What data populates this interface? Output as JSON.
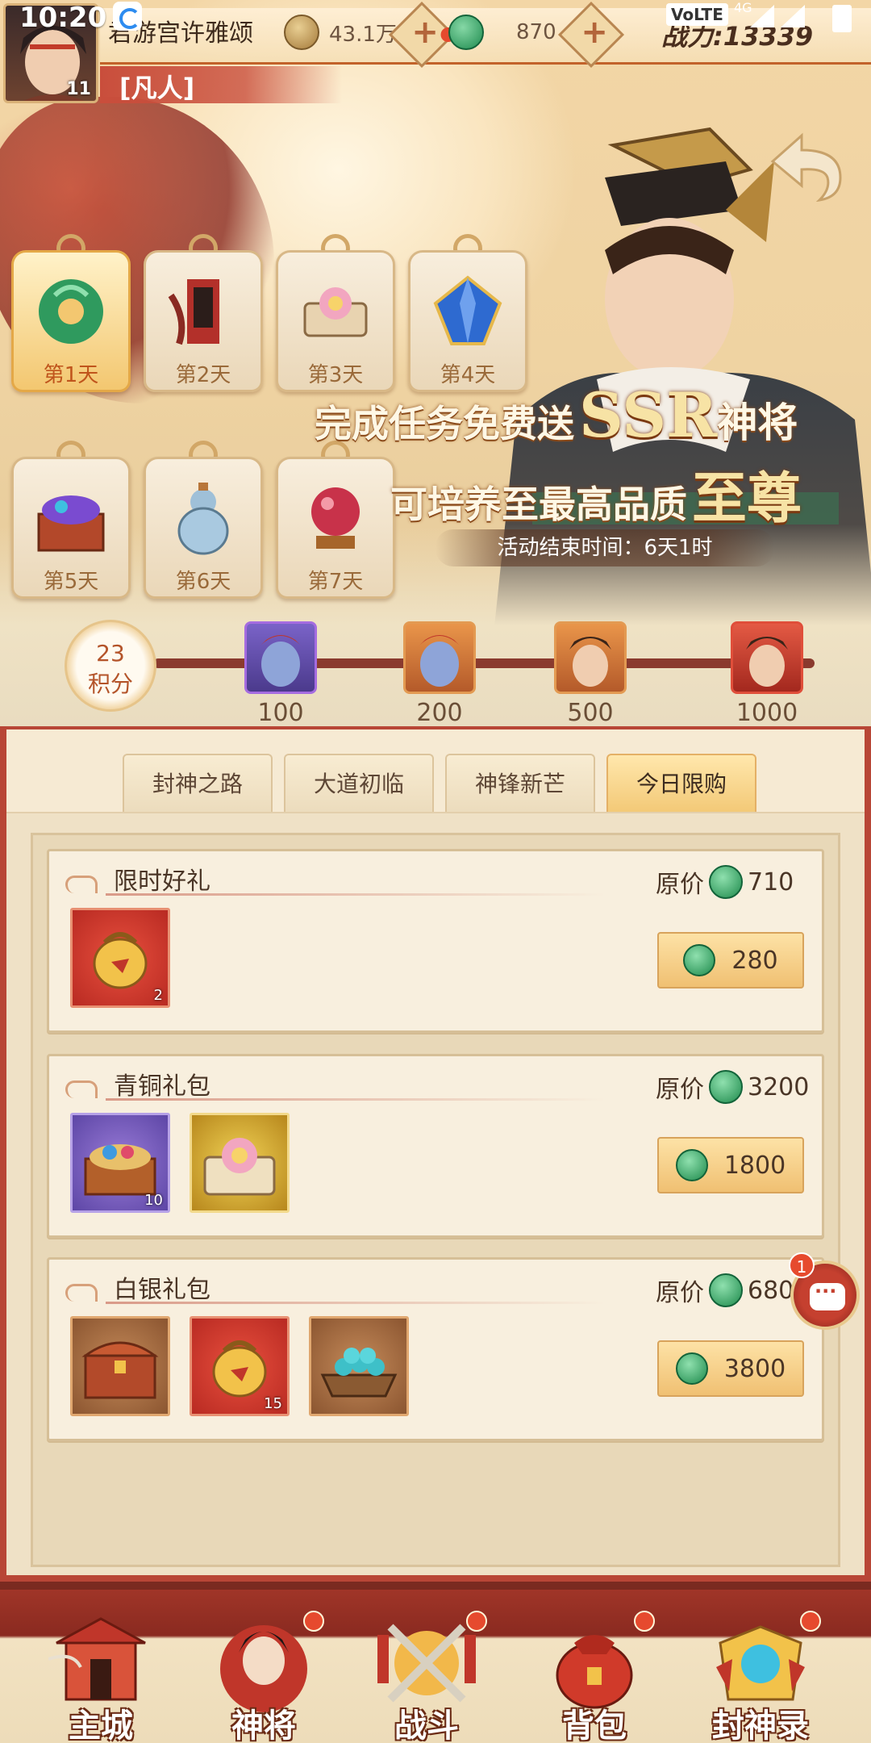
{
  "status_bar": {
    "time": "10:20",
    "volte": "VoLTE",
    "network": "4G"
  },
  "hud": {
    "player_name": "君游宫许雅颂",
    "level": "11",
    "rank": "[凡人]",
    "coins": "43.1万",
    "jade": "870",
    "power": "战力:13339"
  },
  "days": [
    {
      "label": "第1天",
      "icon": "jade-ring-icon",
      "active": true
    },
    {
      "label": "第2天",
      "icon": "war-banner-icon",
      "active": false
    },
    {
      "label": "第3天",
      "icon": "lotus-scroll-icon",
      "active": false
    },
    {
      "label": "第4天",
      "icon": "blue-gem-icon",
      "active": false
    },
    {
      "label": "第5天",
      "icon": "treasure-chest-icon",
      "active": false
    },
    {
      "label": "第6天",
      "icon": "gourd-vase-icon",
      "active": false
    },
    {
      "label": "第7天",
      "icon": "crystal-orb-icon",
      "active": false
    }
  ],
  "promo": {
    "line1_a": "完成任务免费送",
    "line1_b": "SSR",
    "line1_c": "神将",
    "line2_a": "可培养至最高品质",
    "line2_b": "至尊",
    "end_time": "活动结束时间：6天1时"
  },
  "progress": {
    "score": "23",
    "score_unit": "积分",
    "milestones": [
      {
        "label": "100",
        "color": "purple"
      },
      {
        "label": "200",
        "color": "orange"
      },
      {
        "label": "500",
        "color": "orange"
      },
      {
        "label": "1000",
        "color": "red"
      }
    ]
  },
  "tabs": [
    {
      "label": "封神之路",
      "active": false
    },
    {
      "label": "大道初临",
      "active": false
    },
    {
      "label": "神锋新芒",
      "active": false
    },
    {
      "label": "今日限购",
      "active": true
    }
  ],
  "packs": [
    {
      "title": "限时好礼",
      "orig_label": "原价",
      "orig_price": "710",
      "price": "280",
      "items": [
        {
          "type": "red",
          "count": "2",
          "icon": "gold-pouch-icon"
        }
      ]
    },
    {
      "title": "青铜礼包",
      "orig_label": "原价",
      "orig_price": "3200",
      "price": "1800",
      "items": [
        {
          "type": "purple",
          "count": "10",
          "icon": "gem-chest-icon"
        },
        {
          "type": "gold",
          "count": "",
          "icon": "lotus-scroll-icon"
        }
      ]
    },
    {
      "title": "白银礼包",
      "orig_label": "原价",
      "orig_price": "680",
      "price": "3800",
      "items": [
        {
          "type": "brown",
          "count": "",
          "icon": "wooden-chest-icon"
        },
        {
          "type": "red",
          "count": "15",
          "icon": "gold-pouch-icon"
        },
        {
          "type": "brown",
          "count": "",
          "icon": "jade-tray-icon"
        }
      ]
    }
  ],
  "chat": {
    "badge": "1"
  },
  "nav": [
    {
      "label": "主城",
      "icon": "palace-icon"
    },
    {
      "label": "神将",
      "icon": "hero-icon"
    },
    {
      "label": "战斗",
      "icon": "crossed-swords-icon"
    },
    {
      "label": "背包",
      "icon": "bag-icon"
    },
    {
      "label": "封神录",
      "icon": "record-icon"
    }
  ],
  "colors": {
    "accent_red": "#b84636",
    "gold": "#f0c072",
    "jade": "#1e8a4c",
    "badge_red": "#e64a2e"
  }
}
